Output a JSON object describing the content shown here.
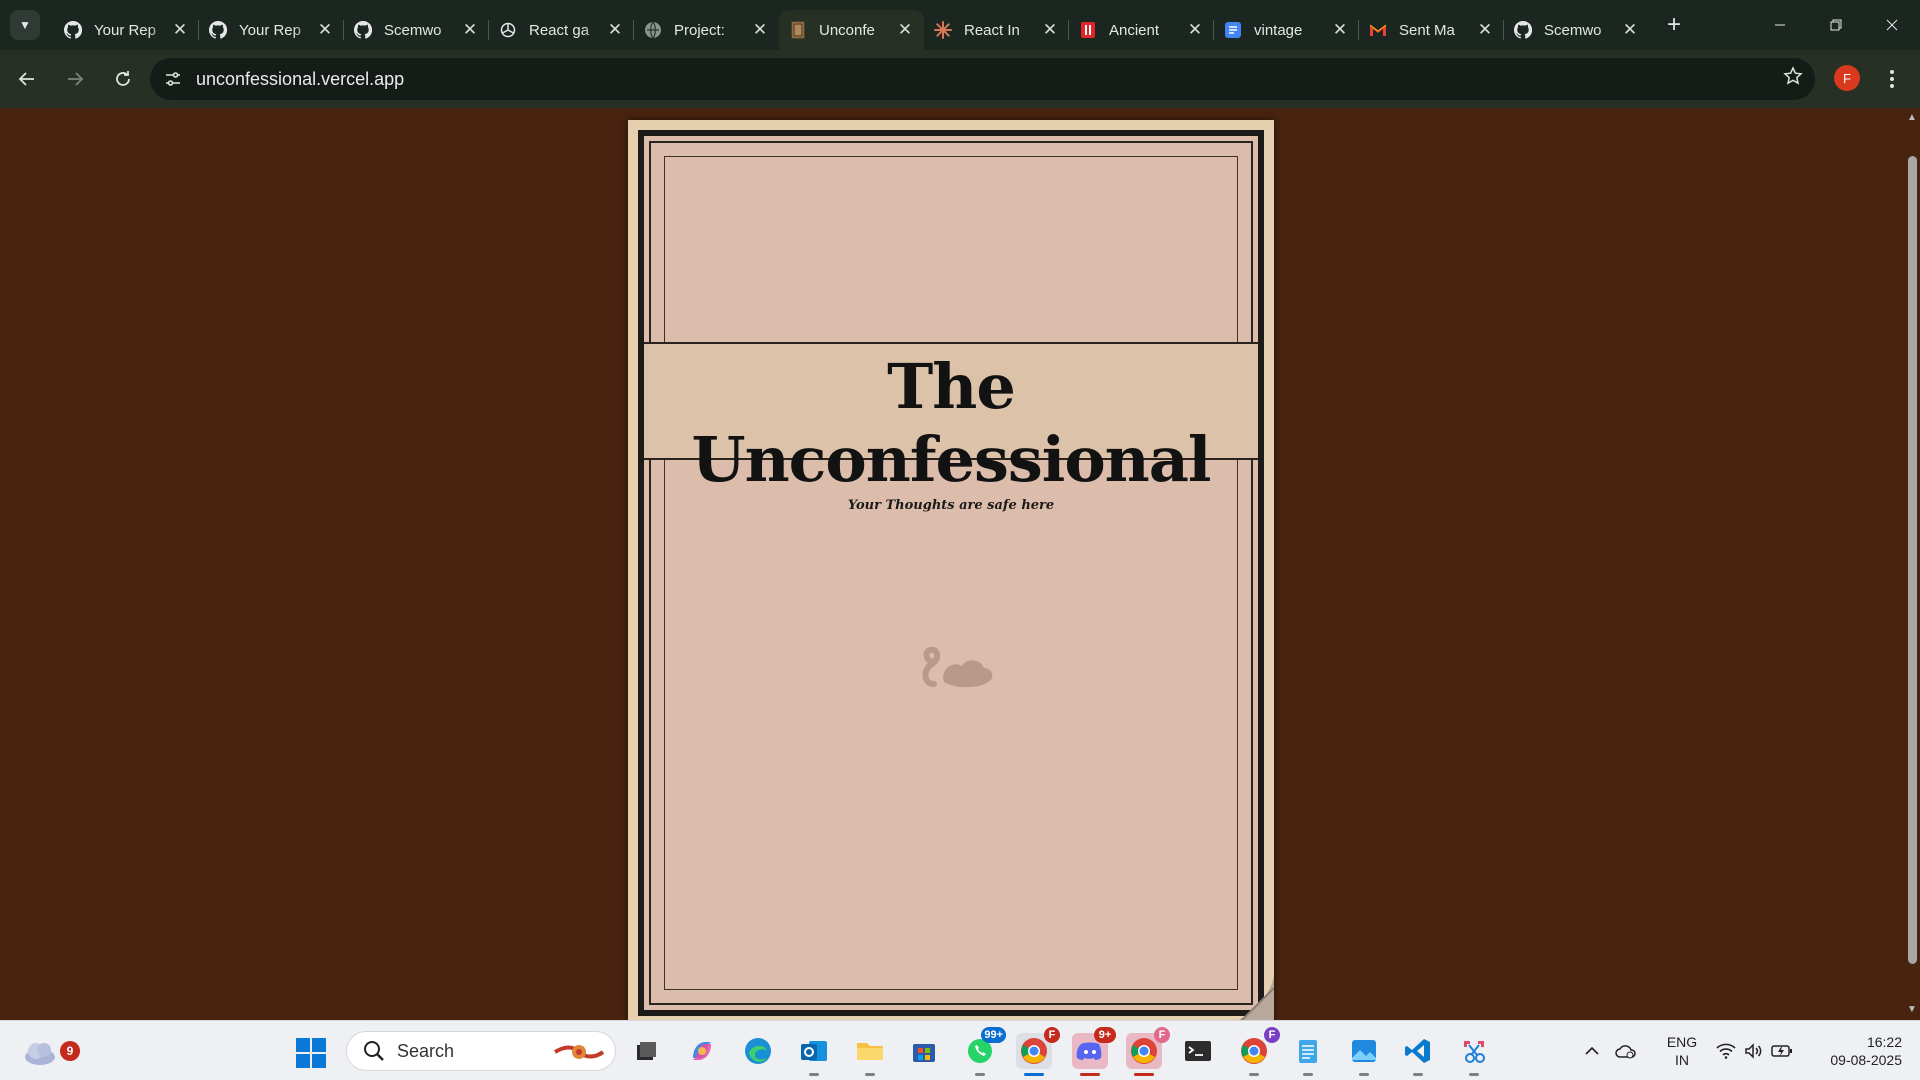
{
  "browser": {
    "tabs": [
      {
        "title": "Your Rep",
        "favicon": "github-icon",
        "active": false
      },
      {
        "title": "Your Rep",
        "favicon": "github-icon",
        "active": false
      },
      {
        "title": "Scemwo",
        "favicon": "github-icon",
        "active": false
      },
      {
        "title": "React ga",
        "favicon": "openai-icon",
        "active": false
      },
      {
        "title": "Project: ",
        "favicon": "globe-icon",
        "active": false
      },
      {
        "title": "Unconfe",
        "favicon": "book-icon",
        "active": true
      },
      {
        "title": "React In",
        "favicon": "claude-icon",
        "active": false
      },
      {
        "title": "Ancient",
        "favicon": "red-doc-icon",
        "active": false
      },
      {
        "title": "vintage",
        "favicon": "google-forms-icon",
        "active": false
      },
      {
        "title": "Sent Ma",
        "favicon": "gmail-icon",
        "active": false
      },
      {
        "title": "Scemwo",
        "favicon": "github-icon",
        "active": false
      }
    ],
    "close_glyph": "✕",
    "new_tab_glyph": "+",
    "url": "unconfessional.vercel.app",
    "profile_initial": "F",
    "colors": {
      "tabstrip": "#1c2620",
      "toolbar": "#263025",
      "omnibox": "#151c17",
      "profile": "#d9391c"
    }
  },
  "page": {
    "background": "#48230f",
    "book": {
      "title": "The Unconfessional",
      "subtitle": "Your Thoughts are safe here",
      "colors": {
        "paper": "#dcbcaa",
        "band": "#dcc2a8",
        "frame": "#1d1b17",
        "cover": "#e6cfae"
      }
    }
  },
  "taskbar": {
    "weather_badge": "9",
    "search_placeholder": "Search",
    "whatsapp_badge": "99+",
    "discord_badge": "9+",
    "profile_badge": "F",
    "language_line1": "ENG",
    "language_line2": "IN",
    "time": "16:22",
    "date": "09-08-2025"
  }
}
